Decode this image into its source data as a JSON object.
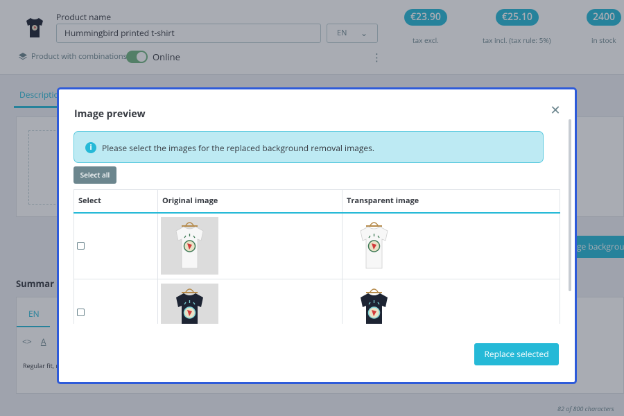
{
  "product": {
    "name_label": "Product name",
    "name_value": "Hummingbird printed t-shirt",
    "language": "EN",
    "combinations_label": "Product with combinations",
    "online_label": "Online",
    "online": true
  },
  "prices": {
    "tax_excl": {
      "value": "€23.90",
      "label": "tax excl."
    },
    "tax_incl": {
      "value": "€25.10",
      "label": "tax incl. (tax rule: 5%)"
    },
    "stock": {
      "value": "2400",
      "label": "in stock"
    }
  },
  "background": {
    "tab_description": "Descriptio",
    "change_bg_button": "ge backgrou",
    "summary_title": "Summar",
    "editor_lang_tab": "EN",
    "editor_excerpt": "Regular fit, r",
    "char_counter": "82 of 800 characters"
  },
  "modal": {
    "title": "Image preview",
    "close_glyph": "✕",
    "alert": {
      "icon": "info-icon",
      "glyph": "i",
      "text": "Please select the images for the replaced background removal images."
    },
    "select_all_label": "Select all",
    "table": {
      "headers": [
        "Select",
        "Original image",
        "Transparent image"
      ],
      "rows": [
        {
          "checked": false,
          "shirt_color": "white",
          "original_image": "white-tshirt-photo",
          "transparent_image": "white-tshirt-transparent"
        },
        {
          "checked": false,
          "shirt_color": "black",
          "original_image": "black-tshirt-photo",
          "transparent_image": "black-tshirt-transparent"
        }
      ]
    },
    "replace_button_label": "Replace selected"
  },
  "colors": {
    "accent": "#25b9d7",
    "modal_border": "#2e5bd9",
    "alert_bg": "#bdeaf3",
    "secondary_button": "#6c868e",
    "toggle_on": "#70b580"
  }
}
